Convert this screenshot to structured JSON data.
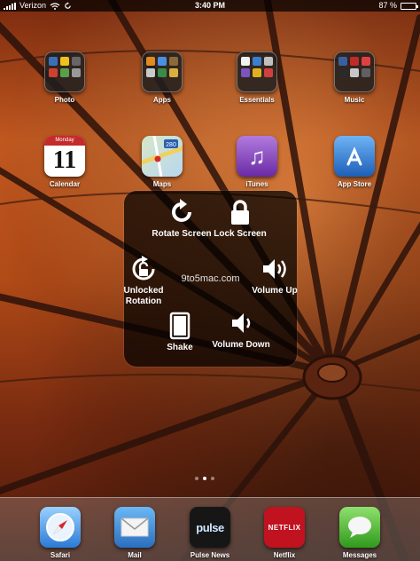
{
  "status_bar": {
    "carrier": "Verizon",
    "time": "3:40 PM",
    "battery_percent": "87 %",
    "battery_level": 0.87
  },
  "home_row1": [
    {
      "label": "Photo",
      "icon": "folder-icon"
    },
    {
      "label": "Apps",
      "icon": "folder-icon"
    },
    {
      "label": "Essentials",
      "icon": "folder-icon"
    },
    {
      "label": "Music",
      "icon": "folder-icon"
    }
  ],
  "home_row2": [
    {
      "label": "Calendar",
      "icon": "calendar-icon",
      "weekday": "Monday",
      "date": "11"
    },
    {
      "label": "Maps",
      "icon": "maps-icon",
      "route": "280"
    },
    {
      "label": "iTunes",
      "icon": "itunes-icon"
    },
    {
      "label": "App Store",
      "icon": "app-store-icon"
    }
  ],
  "assistive_menu": {
    "watermark": "9to5mac.com",
    "rotate": "Rotate Screen",
    "lock": "Lock Screen",
    "unlocked_rotation": "Unlocked Rotation",
    "volume_up": "Volume Up",
    "shake": "Shake",
    "volume_down": "Volume Down"
  },
  "page_dots": {
    "count": 3,
    "active": 1
  },
  "dock": [
    {
      "label": "Safari",
      "icon": "safari-icon"
    },
    {
      "label": "Mail",
      "icon": "mail-icon"
    },
    {
      "label": "Pulse News",
      "icon": "pulse-icon",
      "logo": "pulse"
    },
    {
      "label": "Netflix",
      "icon": "netflix-icon",
      "logo": "NETFLIX"
    },
    {
      "label": "Messages",
      "icon": "messages-icon"
    }
  ],
  "colors": {
    "overlay": "#000000",
    "netflix_red": "#c1121f",
    "calendar_red": "#c42b2b"
  }
}
